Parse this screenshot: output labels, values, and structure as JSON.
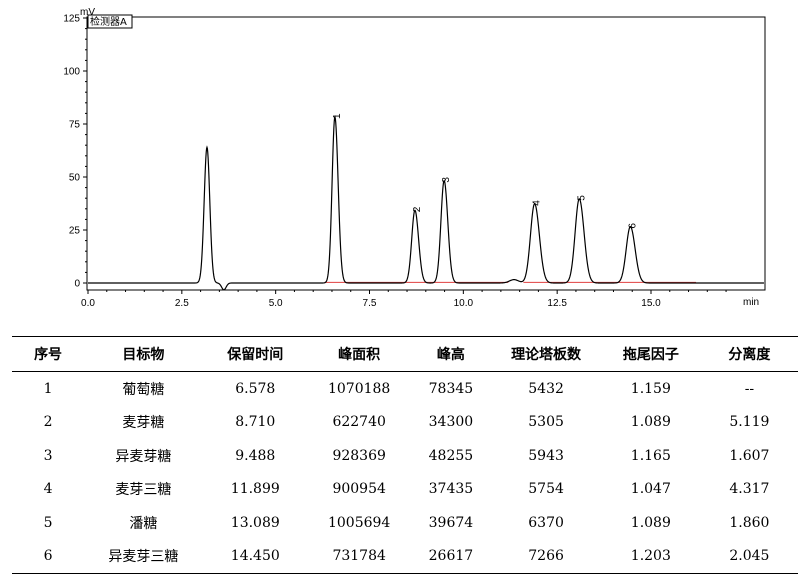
{
  "chart_data": {
    "type": "line",
    "y_unit": "mV",
    "x_unit": "min",
    "detector_label": "检测器A",
    "xlim": [
      0,
      18
    ],
    "ylim": [
      -5,
      125
    ],
    "x_ticks": [
      0,
      2.5,
      5,
      7.5,
      10,
      12.5,
      15
    ],
    "x_tick_labels": [
      "0.0",
      "2.5",
      "5.0",
      "7.5",
      "10.0",
      "12.5",
      "15.0"
    ],
    "y_ticks": [
      0,
      25,
      50,
      75,
      100,
      125
    ],
    "y_tick_labels": [
      "0",
      "25",
      "50",
      "75",
      "100",
      "125"
    ],
    "series_color": "#000000",
    "baseline_color": "#e04040",
    "solvent_peak": {
      "x": 3.17,
      "height": 64,
      "width": 0.075
    },
    "peaks": [
      {
        "label": "1",
        "x": 6.578,
        "height": 78.3,
        "width": 0.075
      },
      {
        "label": "2",
        "x": 8.71,
        "height": 34.3,
        "width": 0.085
      },
      {
        "label": "3",
        "x": 9.488,
        "height": 48.3,
        "width": 0.085
      },
      {
        "label": "4",
        "x": 11.899,
        "height": 37.4,
        "width": 0.11
      },
      {
        "label": "5",
        "x": 13.089,
        "height": 39.7,
        "width": 0.11
      },
      {
        "label": "6",
        "x": 14.45,
        "height": 26.6,
        "width": 0.11
      }
    ],
    "baseline_segments": [
      [
        6.3,
        11.2
      ],
      [
        11.6,
        16.2
      ]
    ]
  },
  "table": {
    "headers": [
      "序号",
      "目标物",
      "保留时间",
      "峰面积",
      "峰高",
      "理论塔板数",
      "拖尾因子",
      "分离度"
    ],
    "rows": [
      [
        "1",
        "葡萄糖",
        "6.578",
        "1070188",
        "78345",
        "5432",
        "1.159",
        "--"
      ],
      [
        "2",
        "麦芽糖",
        "8.710",
        "622740",
        "34300",
        "5305",
        "1.089",
        "5.119"
      ],
      [
        "3",
        "异麦芽糖",
        "9.488",
        "928369",
        "48255",
        "5943",
        "1.165",
        "1.607"
      ],
      [
        "4",
        "麦芽三糖",
        "11.899",
        "900954",
        "37435",
        "5754",
        "1.047",
        "4.317"
      ],
      [
        "5",
        "潘糖",
        "13.089",
        "1005694",
        "39674",
        "6370",
        "1.089",
        "1.860"
      ],
      [
        "6",
        "异麦芽三糖",
        "14.450",
        "731784",
        "26617",
        "7266",
        "1.203",
        "2.045"
      ]
    ]
  }
}
